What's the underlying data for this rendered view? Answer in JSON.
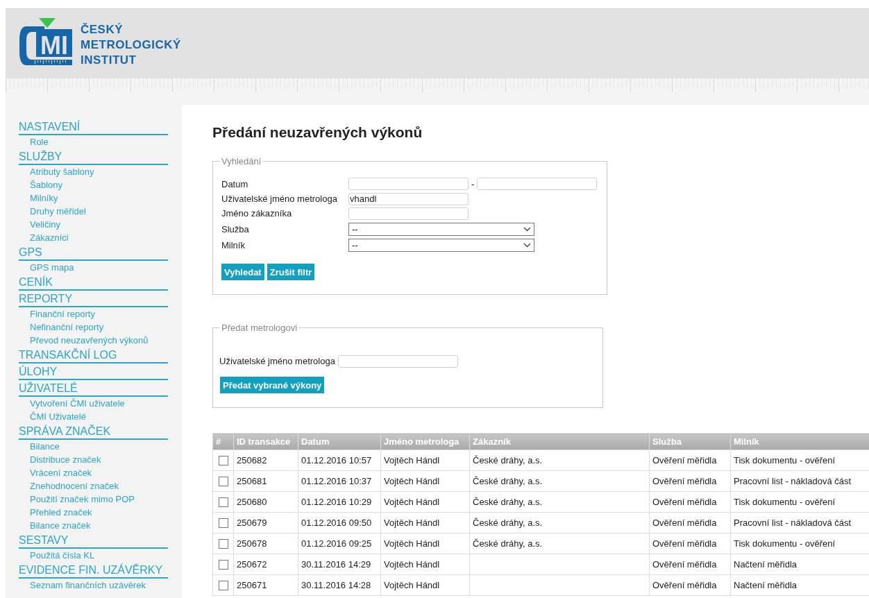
{
  "header": {
    "logo_mark": "MI",
    "logo_lines": [
      "ČESKÝ",
      "METROLOGICKÝ",
      "INSTITUT"
    ]
  },
  "sidebar": {
    "sections": [
      {
        "heading": "NASTAVENÍ",
        "items": [
          "Role"
        ]
      },
      {
        "heading": "SLUŽBY",
        "items": [
          "Atributy šablony",
          "Šablony",
          "Milníky",
          "Druhy měřidel",
          "Veličiny",
          "Zákazníci"
        ]
      },
      {
        "heading": "GPS",
        "items": [
          "GPS mapa"
        ]
      },
      {
        "heading": "CENÍK"
      },
      {
        "heading": "REPORTY",
        "items": [
          "Finanční reporty",
          "Nefinanční reporty",
          "Převod neuzavřených výkonů"
        ]
      },
      {
        "heading": "TRANSAKČNÍ LOG"
      },
      {
        "heading": "ÚLOHY"
      },
      {
        "heading": "UŽIVATELÉ",
        "items": [
          "Vytvoření ČMI uživatele",
          "ČMI Uživatelé"
        ]
      },
      {
        "heading": "SPRÁVA ZNAČEK",
        "items": [
          "Bilance",
          "Distribuce značek",
          "Vrácení značek",
          "Znehodnocení značek",
          "Použití značek mimo POP",
          "Přehled značek",
          "Bilance značek"
        ]
      },
      {
        "heading": "SESTAVY",
        "items": [
          "Použitá čísla KL"
        ]
      },
      {
        "heading": "EVIDENCE FIN. UZÁVĚRKY",
        "items": [
          "Seznam finančních uzávěrek"
        ]
      }
    ]
  },
  "page_title": "Předání neuzavřených výkonů",
  "search": {
    "legend": "Vyhledání",
    "date_label": "Datum",
    "date_separator": "-",
    "user_label": "Uživatelské jméno metrologa",
    "user_value": "vhandl",
    "customer_label": "Jméno zákazníka",
    "service_label": "Služba",
    "service_value": "--",
    "milestone_label": "Milník",
    "milestone_value": "--",
    "buttons": [
      "Vyhledat",
      "Zrušit filtr"
    ]
  },
  "transfer": {
    "legend": "Předat metrologovi",
    "user_label": "Uživatelské jméno metrologa",
    "button": "Předat vybrané výkony"
  },
  "table": {
    "columns": [
      "#",
      "ID transakce",
      "Datum",
      "Jméno metrologa",
      "Zákazník",
      "Služba",
      "Milník"
    ],
    "rows": [
      {
        "checked": false,
        "cells": [
          "",
          "250682",
          "01.12.2016 10:57",
          "Vojtěch Hándl",
          "České dráhy, a.s.",
          "Ověření měřidla",
          "Tisk dokumentu - ověření"
        ]
      },
      {
        "checked": false,
        "cells": [
          "",
          "250681",
          "01.12.2016 10:37",
          "Vojtěch Hándl",
          "České dráhy, a.s.",
          "Ověření měřidla",
          "Pracovní list - nákladová část"
        ]
      },
      {
        "checked": false,
        "cells": [
          "",
          "250680",
          "01.12.2016 10:29",
          "Vojtěch Hándl",
          "České dráhy, a.s.",
          "Ověření měřidla",
          "Tisk dokumentu - ověření"
        ]
      },
      {
        "checked": false,
        "cells": [
          "",
          "250679",
          "01.12.2016 09:50",
          "Vojtěch Hándl",
          "České dráhy, a.s.",
          "Ověření měřidla",
          "Pracovní list - nákladová část"
        ]
      },
      {
        "checked": false,
        "cells": [
          "",
          "250678",
          "01.12.2016 09:25",
          "Vojtěch Hándl",
          "České dráhy, a.s.",
          "Ověření měřidla",
          "Tisk dokumentu - ověření"
        ]
      },
      {
        "checked": false,
        "cells": [
          "",
          "250672",
          "30.11.2016 14:29",
          "Vojtěch Hándl",
          "",
          "Ověření měřidla",
          "Načtení měřidla"
        ]
      },
      {
        "checked": false,
        "cells": [
          "",
          "250671",
          "30.11.2016 14:28",
          "Vojtěch Hándl",
          "",
          "Ověření měřidla",
          "Načtení měřidla"
        ]
      }
    ]
  }
}
